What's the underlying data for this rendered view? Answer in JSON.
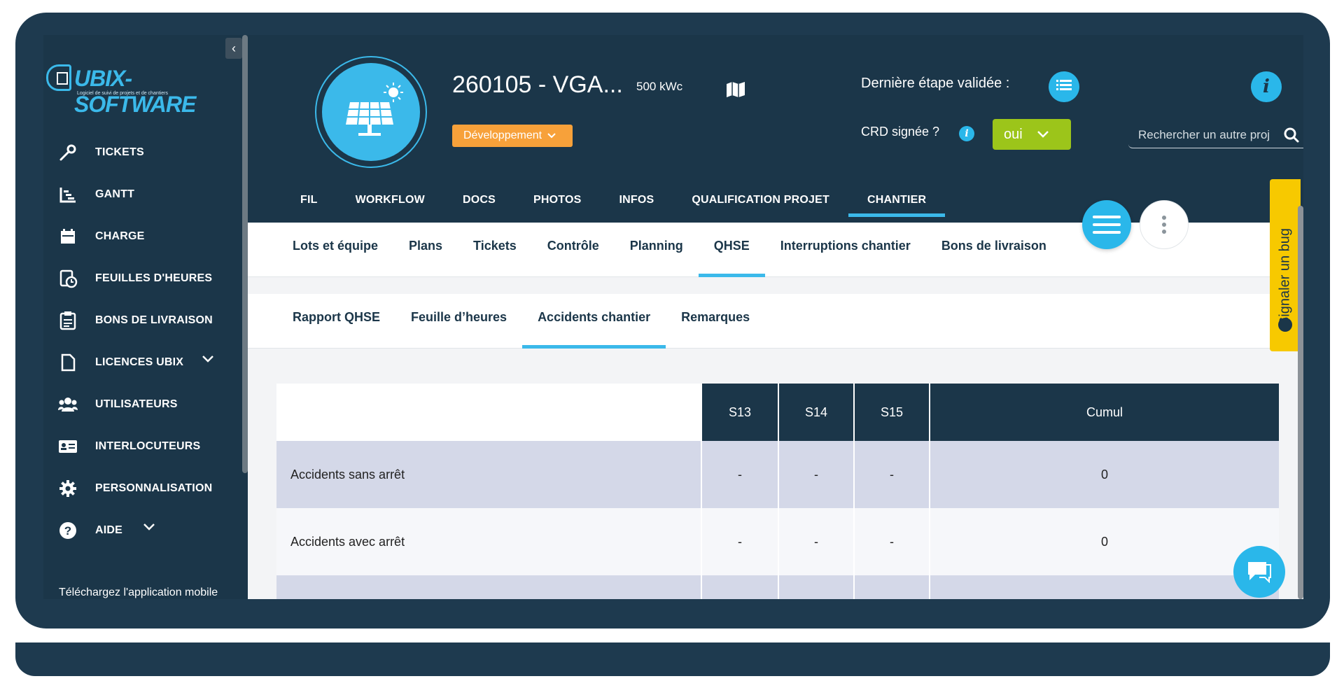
{
  "brand": {
    "name": "UBIX-SOFTWARE",
    "tagline": "Logiciel de suivi de projets et de chantiers"
  },
  "sidebar": {
    "collapse_glyph": "‹",
    "items": [
      {
        "label": "TICKETS",
        "icon": "wrench-icon"
      },
      {
        "label": "GANTT",
        "icon": "gantt-icon"
      },
      {
        "label": "CHARGE",
        "icon": "calendar-icon"
      },
      {
        "label": "FEUILLES D'HEURES",
        "icon": "timesheet-icon"
      },
      {
        "label": "BONS DE LIVRAISON",
        "icon": "clipboard-icon"
      },
      {
        "label": "LICENCES UBIX",
        "icon": "document-icon",
        "expandable": true
      },
      {
        "label": "UTILISATEURS",
        "icon": "users-icon"
      },
      {
        "label": "INTERLOCUTEURS",
        "icon": "contact-card-icon"
      },
      {
        "label": "PERSONNALISATION",
        "icon": "gear-icon"
      },
      {
        "label": "AIDE",
        "icon": "help-icon",
        "expandable": true
      }
    ],
    "mobile_download": "Téléchargez l'application mobile"
  },
  "project": {
    "title": "260105 - VGA...",
    "power": "500 kWc",
    "status": "Développement",
    "last_step_label": "Dernière étape validée :",
    "crd_label": "CRD signée ?",
    "crd_value": "oui",
    "info_glyph": "i",
    "search_placeholder": "Rechercher un autre proj"
  },
  "main_tabs": [
    {
      "label": "FIL",
      "active": false
    },
    {
      "label": "WORKFLOW",
      "active": false
    },
    {
      "label": "DOCS",
      "active": false
    },
    {
      "label": "PHOTOS",
      "active": false
    },
    {
      "label": "INFOS",
      "active": false
    },
    {
      "label": "QUALIFICATION PROJET",
      "active": false
    },
    {
      "label": "CHANTIER",
      "active": true
    }
  ],
  "sub_tabs": [
    {
      "label": "Lots et équipe",
      "active": false
    },
    {
      "label": "Plans",
      "active": false
    },
    {
      "label": "Tickets",
      "active": false
    },
    {
      "label": "Contrôle",
      "active": false
    },
    {
      "label": "Planning",
      "active": false
    },
    {
      "label": "QHSE",
      "active": true
    },
    {
      "label": "Interruptions chantier",
      "active": false
    },
    {
      "label": "Bons de livraison",
      "active": false
    }
  ],
  "qhse_tabs": [
    {
      "label": "Rapport QHSE",
      "active": false
    },
    {
      "label": "Feuille d’heures",
      "active": false
    },
    {
      "label": "Accidents chantier",
      "active": true
    },
    {
      "label": "Remarques",
      "active": false
    }
  ],
  "table": {
    "headers": [
      "S13",
      "S14",
      "S15",
      "Cumul"
    ],
    "rows": [
      {
        "label": "Accidents sans arrêt",
        "values": [
          "-",
          "-",
          "-",
          "0"
        ]
      },
      {
        "label": "Accidents avec arrêt",
        "values": [
          "-",
          "-",
          "-",
          "0"
        ]
      },
      {
        "label": "",
        "values": [
          "",
          "",
          "",
          ""
        ]
      }
    ]
  },
  "bug_report": {
    "label": "Signaler un bug"
  },
  "colors": {
    "navy": "#1b3649",
    "accent": "#2ab7ea",
    "status_orange": "#f7a13a",
    "crd_green": "#9cc51a",
    "bug_yellow": "#f7c900",
    "row_shade": "#d4d8e8"
  }
}
